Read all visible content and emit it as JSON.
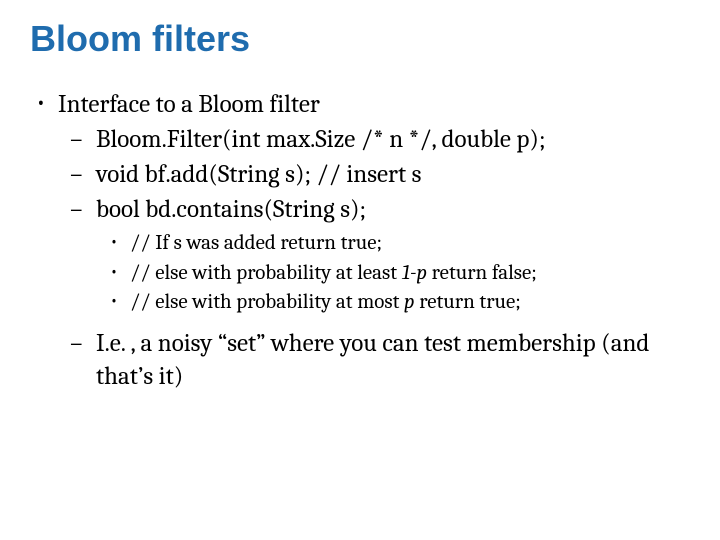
{
  "title": "Bloom filters",
  "b1": "Interface to a Bloom filter",
  "b2a": "Bloom.Filter(int max.Size /* n */, double p);",
  "b2b": "void bf.add(String s); // insert s",
  "b2c": "bool bd.contains(String s);",
  "b3a_pre": "// If s was added return true;",
  "b3b_pre": "// else with probability at least ",
  "b3b_it": "1-p",
  "b3b_post": " return false;",
  "b3c_pre": "// else with probability at most ",
  "b3c_it": "p",
  "b3c_post": " return true;",
  "b2d": "I.e. , a noisy “set” where you can test membership (and that’s it)"
}
